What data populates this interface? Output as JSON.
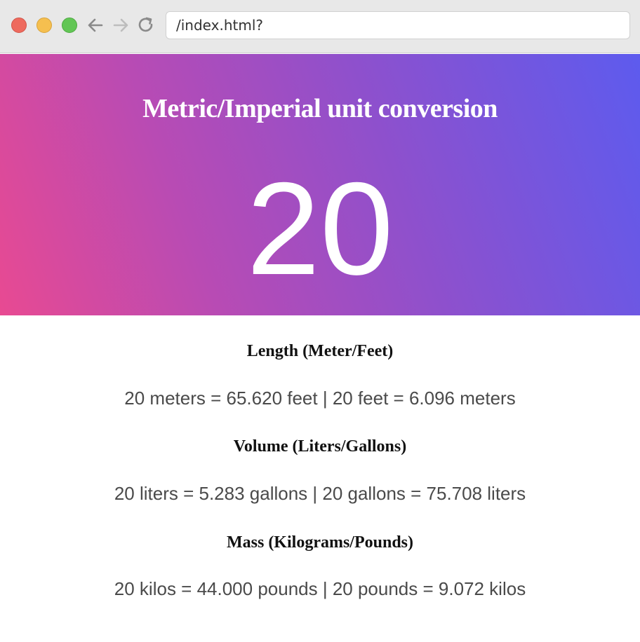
{
  "browser": {
    "address": "/index.html?",
    "icons": [
      "close-icon",
      "minimize-icon",
      "maximize-icon",
      "back-arrow-icon",
      "forward-arrow-icon",
      "reload-icon"
    ]
  },
  "hero": {
    "title": "Metric/Imperial unit conversion",
    "value": "20",
    "gradient": [
      "#e84a92",
      "#5d5bee"
    ]
  },
  "sections": [
    {
      "heading": "Length (Meter/Feet)",
      "text": "20 meters = 65.620 feet | 20 feet = 6.096 meters"
    },
    {
      "heading": "Volume (Liters/Gallons)",
      "text": "20 liters = 5.283 gallons | 20 gallons = 75.708 liters"
    },
    {
      "heading": "Mass (Kilograms/Pounds)",
      "text": "20 kilos = 44.000 pounds | 20 pounds = 9.072 kilos"
    }
  ]
}
